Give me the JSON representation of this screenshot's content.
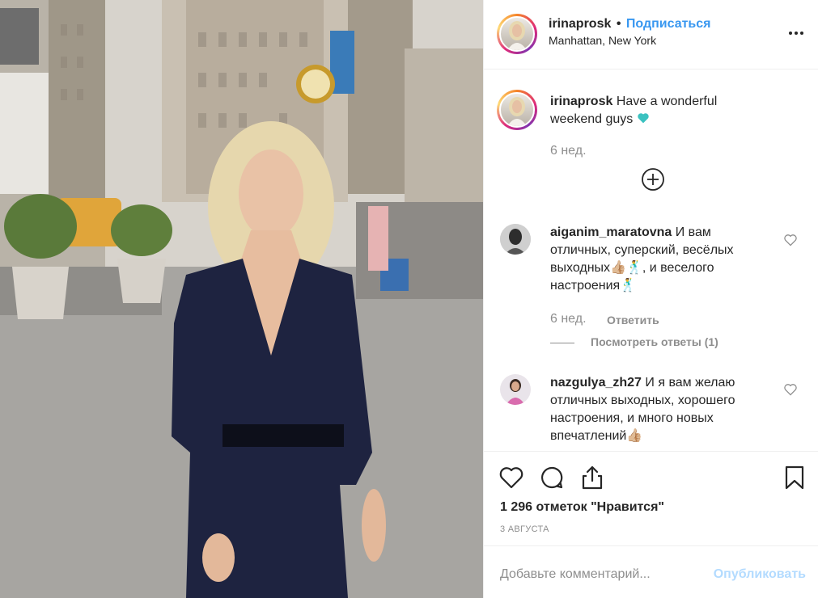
{
  "header": {
    "username": "irinaprosk",
    "separator": "•",
    "follow_label": "Подписаться",
    "location": "Manhattan, New York",
    "more_icon": "more-horizontal-icon"
  },
  "caption": {
    "username": "irinaprosk",
    "text": "Have a wonderful weekend guys",
    "emoji": "teal-heart-icon",
    "time": "6 нед."
  },
  "comments": [
    {
      "username": "aiganim_maratovna",
      "text": "И вам отличных, суперский, весёлых выходных👍🏼🕺, и веселого настроения🕺",
      "time": "6 нед.",
      "reply_label": "Ответить",
      "view_replies_label": "Посмотреть ответы (1)"
    },
    {
      "username": "nazgulya_zh27",
      "text": "И я вам желаю отличных выходных, хорошего настроения, и много новых впечатлений👍🏼"
    }
  ],
  "actions": {
    "likes": "1 296 отметок \"Нравится\"",
    "date": "3 АВГУСТА"
  },
  "add_comment": {
    "placeholder": "Добавьте комментарий...",
    "publish_label": "Опубликовать"
  },
  "colors": {
    "link_blue": "#3897f0",
    "publish_disabled": "#b3dbff",
    "muted": "#8e8e8e",
    "text": "#262626",
    "heart_teal": "#3bc2c0"
  }
}
